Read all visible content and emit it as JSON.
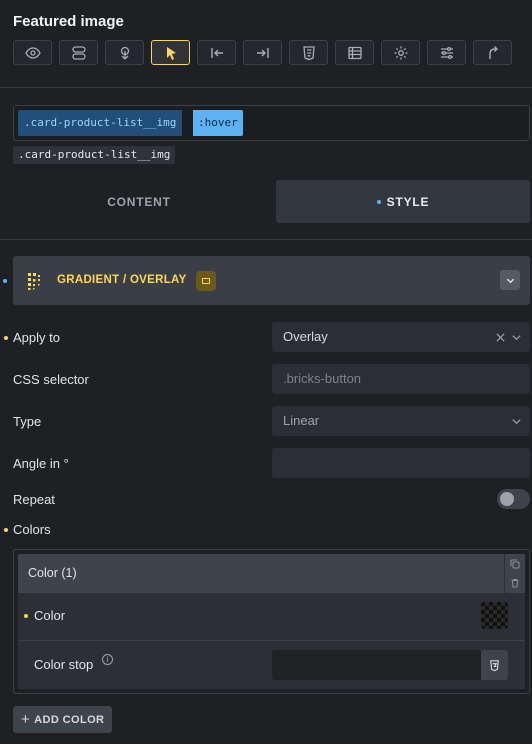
{
  "panel": {
    "title": "Featured image"
  },
  "toolbar": {
    "icons": [
      "eye-icon",
      "toggle-icon",
      "touch-icon",
      "cursor-icon",
      "arrow-left-bar-icon",
      "arrow-right-bar-icon",
      "html5-icon",
      "list-icon",
      "gear-icon",
      "sliders-icon",
      "arrow-up-turn-icon"
    ],
    "active_index": 3
  },
  "selector": {
    "main": ".card-product-list__img",
    "state": ":hover",
    "tag": ".card-product-list__img"
  },
  "tabs": {
    "content": "CONTENT",
    "style": "STYLE"
  },
  "group": {
    "label": "GRADIENT / OVERLAY"
  },
  "fields": {
    "apply_to": {
      "label": "Apply to",
      "value": "Overlay"
    },
    "css_selector": {
      "label": "CSS selector",
      "placeholder": ".bricks-button"
    },
    "type": {
      "label": "Type",
      "value": "Linear"
    },
    "angle": {
      "label": "Angle in °",
      "value": ""
    },
    "repeat": {
      "label": "Repeat",
      "on": false
    }
  },
  "colors": {
    "label": "Colors",
    "items": [
      {
        "title": "Color (1)",
        "color_label": "Color",
        "stop_label": "Color stop",
        "stop_value": ""
      }
    ],
    "add_label": "ADD COLOR"
  },
  "theme": {
    "accent": "#ffd64f",
    "selector_blue": "#5bb3f5",
    "bg": "#1e2024"
  }
}
